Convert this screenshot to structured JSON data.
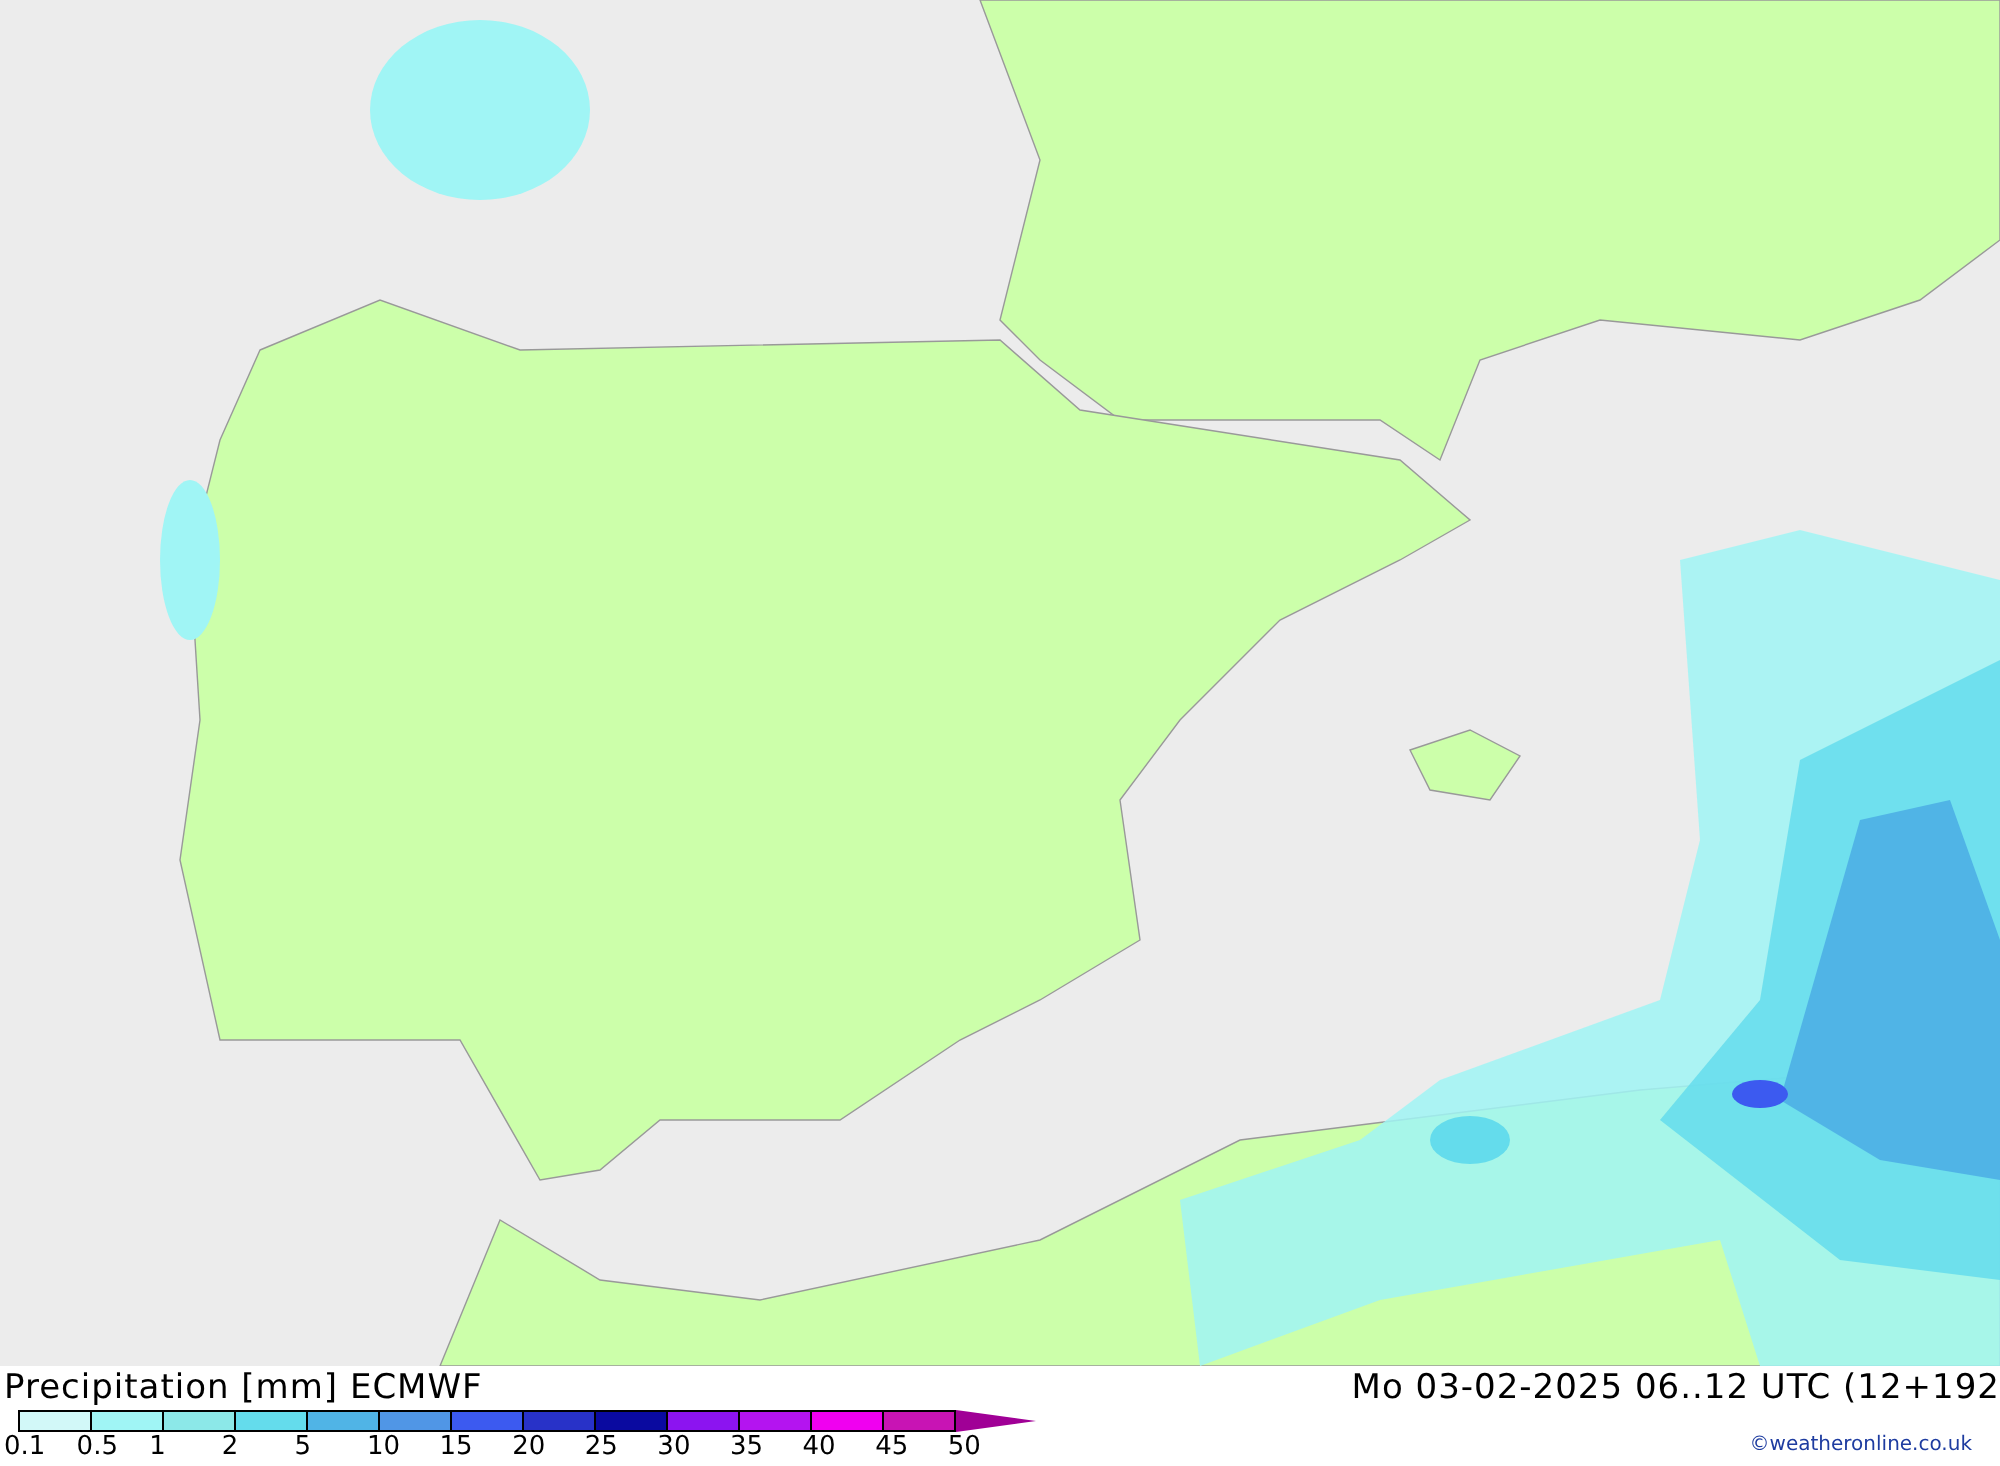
{
  "title": "Precipitation [mm] ECMWF",
  "valid_time": "Mo 03-02-2025 06..12 UTC (12+192",
  "credit": "©weatheronline.co.uk",
  "legend": {
    "swatches": [
      {
        "color": "#d2f8f8"
      },
      {
        "color": "#a0f5f5"
      },
      {
        "color": "#8ce8e8"
      },
      {
        "color": "#64dcec"
      },
      {
        "color": "#50b4e6"
      },
      {
        "color": "#5096e6"
      },
      {
        "color": "#3c5af0"
      },
      {
        "color": "#2832c8"
      },
      {
        "color": "#0a0aa0"
      },
      {
        "color": "#8c14f0"
      },
      {
        "color": "#b414f0"
      },
      {
        "color": "#f000f0"
      },
      {
        "color": "#c814b4"
      }
    ],
    "arrow": {
      "color": "#a00096"
    },
    "labels": [
      "0.1",
      "0.5",
      "1",
      "2",
      "5",
      "10",
      "15",
      "20",
      "25",
      "30",
      "35",
      "40",
      "45",
      "50"
    ]
  }
}
